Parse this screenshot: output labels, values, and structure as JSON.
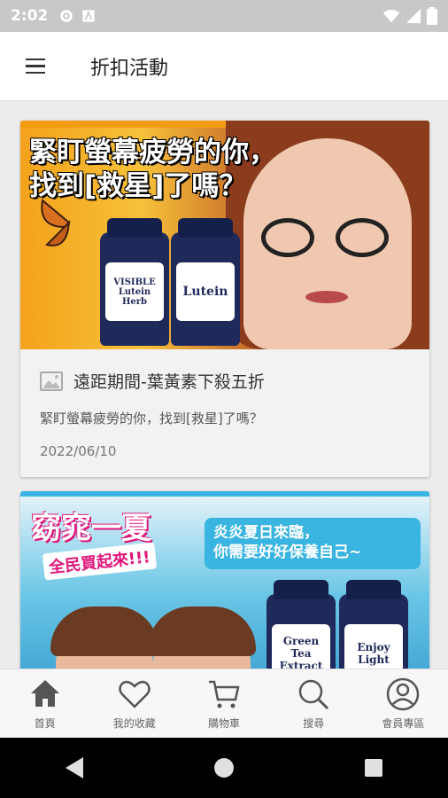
{
  "status_bar": {
    "time": "2:02"
  },
  "app_bar": {
    "title": "折扣活動"
  },
  "cards": [
    {
      "banner_line1": "緊盯螢幕疲勞的你，",
      "banner_line2": "找到[救星]了嗎？",
      "bottle1_label": "VISIBLE Lutein Herb",
      "bottle2_label": "Lutein",
      "title": "遠距期間-葉黃素下殺五折",
      "description": "緊盯螢幕疲勞的你，找到[救星]了嗎？",
      "date": "2022/06/10"
    },
    {
      "banner_title": "窈窕一夏",
      "banner_sub": "全民買起來!!!",
      "banner_box_line1": "炎炎夏日來臨，",
      "banner_box_line2": "你需要好好保養自己~",
      "bottle1_label": "Green Tea Extract",
      "bottle2_label": "Enjoy Light"
    }
  ],
  "bottom_nav": [
    {
      "label": "首頁",
      "icon": "home-icon",
      "active": true
    },
    {
      "label": "我的收藏",
      "icon": "heart-icon"
    },
    {
      "label": "購物車",
      "icon": "cart-icon"
    },
    {
      "label": "搜尋",
      "icon": "search-icon"
    },
    {
      "label": "會員專區",
      "icon": "user-icon"
    }
  ],
  "colors": {
    "accent": "#555555",
    "status_bar": "#c8c8c8",
    "nav_background": "#f7f7f7"
  }
}
